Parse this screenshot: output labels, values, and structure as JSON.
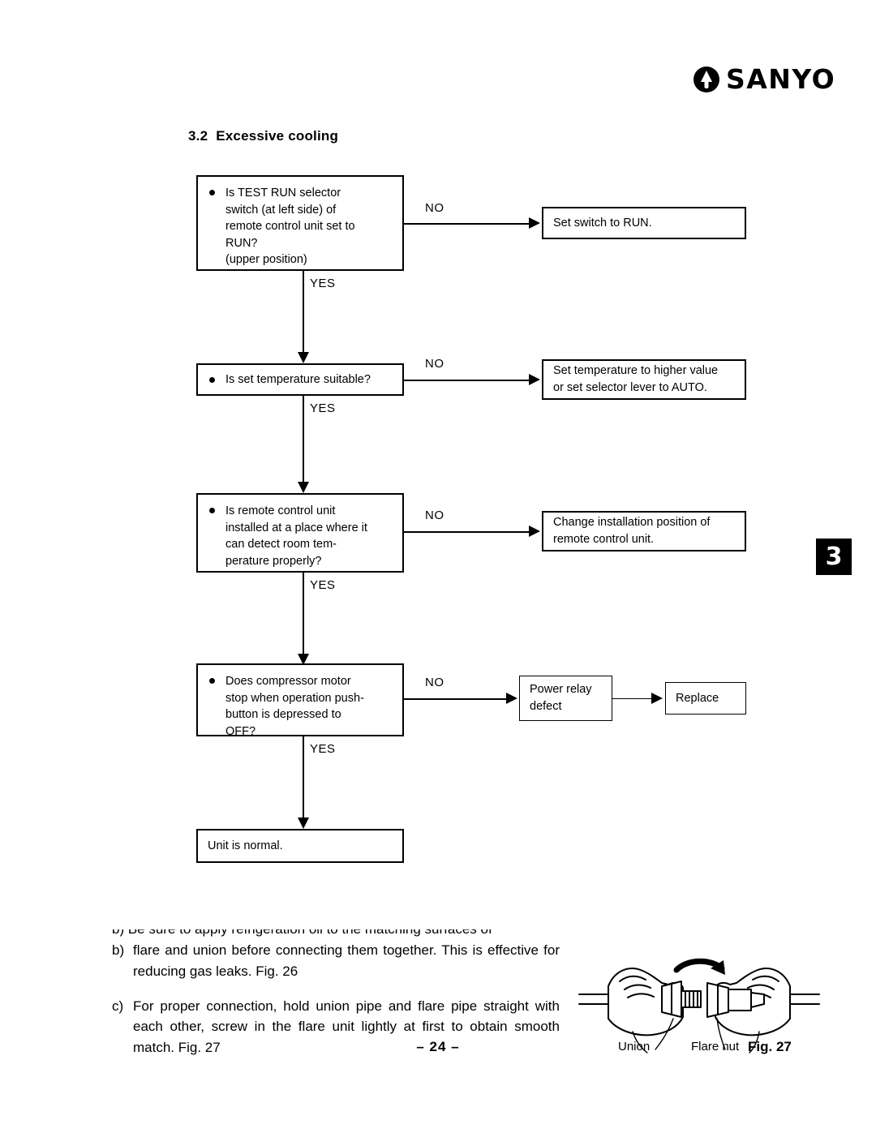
{
  "brand": {
    "logo_text": "SANYO",
    "logo_mark": "sanyo-emblem"
  },
  "section": {
    "number": "3.2",
    "title": "Excessive cooling"
  },
  "chapter_tab": {
    "label": "3"
  },
  "flowchart": {
    "yes_label": "YES",
    "no_label": "NO",
    "steps": [
      {
        "question": "Is TEST RUN selector switch (at left side) of remote control unit set to RUN? (upper position)",
        "question_lines": [
          "Is TEST RUN selector",
          "switch (at left side) of",
          "remote control unit set to",
          "RUN?",
          "(upper position)"
        ],
        "no_label": "NO",
        "yes_label": "YES",
        "action_lines": [
          "Set switch to RUN."
        ]
      },
      {
        "question": "Is set temperature suitable?",
        "question_lines": [
          "Is set temperature suitable?"
        ],
        "no_label": "NO",
        "yes_label": "YES",
        "action_lines": [
          "Set temperature to higher value",
          "or set selector lever to AUTO."
        ]
      },
      {
        "question": "Is remote control unit installed at a place where it can detect room temperature properly?",
        "question_lines": [
          "Is remote control unit",
          "installed at a place where it",
          "can detect room tem-",
          "perature properly?"
        ],
        "no_label": "NO",
        "yes_label": "YES",
        "action_lines": [
          "Change installation position of",
          "remote control unit."
        ]
      },
      {
        "question": "Does compressor motor stop when operation push-button is depressed to OFF?",
        "question_lines": [
          "Does compressor motor",
          "stop when operation push-",
          "button is depressed to",
          "OFF?"
        ],
        "no_label": "NO",
        "yes_label": "YES",
        "action_lines": [
          "Power relay",
          "defect"
        ],
        "followup_lines": [
          "Replace"
        ]
      }
    ],
    "terminal": "Unit is normal."
  },
  "instructions": {
    "clipped_line": "b) Be sure to apply refrigeration oil to the matching surfaces of",
    "items": [
      {
        "marker": "b)",
        "text": "flare and union before connecting them together.  This is effective for reducing gas leaks. Fig. 26"
      },
      {
        "marker": "c)",
        "text": "For proper connection, hold union pipe and flare pipe straight with each other, screw in the flare unit lightly at first to obtain smooth match. Fig. 27"
      }
    ]
  },
  "figure": {
    "caption": "Fig. 27",
    "label_left": "Union",
    "label_right": "Flare nut"
  },
  "page_number": "– 24 –"
}
